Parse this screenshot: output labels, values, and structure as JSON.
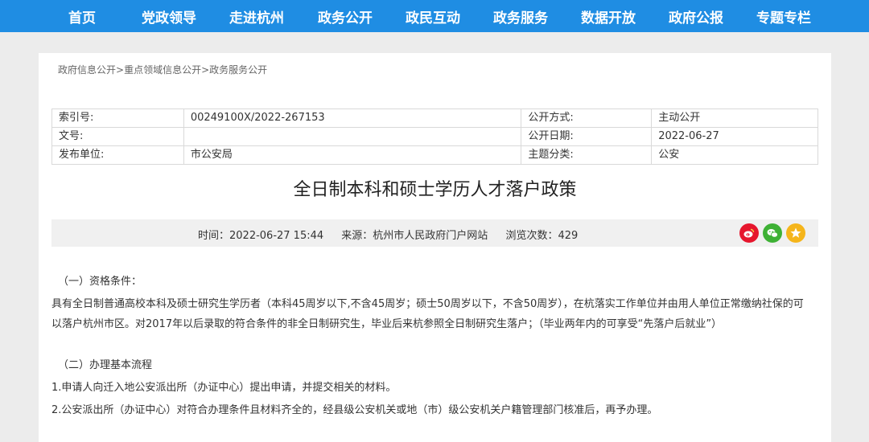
{
  "nav": {
    "items": [
      "首页",
      "党政领导",
      "走进杭州",
      "政务公开",
      "政民互动",
      "政务服务",
      "数据开放",
      "政府公报",
      "专题专栏"
    ]
  },
  "breadcrumb": [
    "政府信息公开",
    "重点领域信息公开",
    "政务服务公开"
  ],
  "breadcrumb_sep": ">",
  "meta": {
    "rows": [
      [
        "索引号:",
        "00249100X/2022-267153",
        "公开方式:",
        "主动公开"
      ],
      [
        "文号:",
        "",
        "公开日期:",
        "2022-06-27"
      ],
      [
        "发布单位:",
        "市公安局",
        "主题分类:",
        "公安"
      ]
    ]
  },
  "article": {
    "title": "全日制本科和硕士学历人才落户政策",
    "time": "时间：2022-06-27 15:44",
    "source": "来源：杭州市人民政府门户网站",
    "views": "浏览次数：429",
    "paragraphs": [
      "（一）资格条件：",
      "具有全日制普通高校本科及硕士研究生学历者（本科45周岁以下,不含45周岁；硕士50周岁以下，不含50周岁），在杭落实工作单位并由用人单位正常缴纳社保的可以落户杭州市区。对2017年以后录取的符合条件的非全日制研究生，毕业后来杭参照全日制研究生落户；（毕业两年内的可享受“先落户后就业”）",
      "",
      "（二）办理基本流程",
      "1.申请人向迁入地公安派出所（办证中心）提出申请，并提交相关的材料。",
      "2.公安派出所（办证中心）对符合办理条件且材料齐全的，经县级公安机关或地（市）级公安机关户籍管理部门核准后，再予办理。"
    ]
  },
  "share": {
    "weibo_color": "#e6162d",
    "wechat_color": "#3eb135",
    "qzone_color": "#f5b51b"
  }
}
